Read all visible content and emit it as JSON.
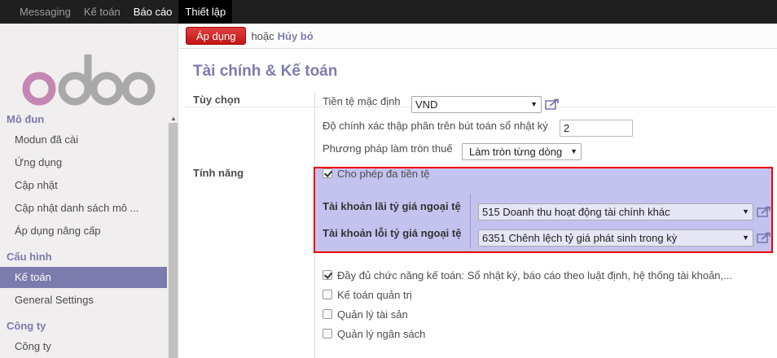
{
  "topbar": {
    "items": [
      "Messaging",
      "Kế toán",
      "Báo cáo",
      "Thiết lập"
    ]
  },
  "sidebar": {
    "sections": [
      {
        "title": "Mô đun",
        "items": [
          "Modun đã cài",
          "Ứng dụng",
          "Cập nhật",
          "Cập nhật danh sách mô ...",
          "Áp dụng nâng cấp"
        ]
      },
      {
        "title": "Cấu hình",
        "items": [
          "Kế toán",
          "General Settings"
        ]
      },
      {
        "title": "Công ty",
        "items": [
          "Công ty"
        ]
      }
    ],
    "active_item": "Kế toán"
  },
  "control_panel": {
    "apply_label": "Áp dụng",
    "or_label": "hoặc",
    "cancel_label": "Hủy bỏ"
  },
  "page_title": "Tài chính & Kế toán",
  "options": {
    "label": "Tùy chọn",
    "currency_label": "Tiền tệ mặc định",
    "currency_value": "VND",
    "precision_label": "Độ chính xác thập phân trên bút toán sổ nhật ký",
    "precision_value": "2",
    "rounding_label": "Phương pháp làm tròn thuế",
    "rounding_value": "Làm tròn từng dòng"
  },
  "features": {
    "label": "Tính năng",
    "multi_currency_label": "Cho phép đa tiền tệ",
    "multi_currency_checked": true,
    "gain_account_label": "Tài khoản lãi tỷ giá ngoại tệ",
    "gain_account_value": "515 Doanh thu hoạt động tài chính khác",
    "loss_account_label": "Tài khoản lỗi tỷ giá ngoại tệ",
    "loss_account_value": "6351 Chênh lệch tỷ giá phát sinh trong kỳ",
    "checkboxes": [
      {
        "label": "Đầy đủ chức năng kế toán: Sổ nhật ký, báo cáo theo luật định, hệ thống tài khoản,...",
        "checked": true
      },
      {
        "label": "Kế toán quản trị",
        "checked": false
      },
      {
        "label": "Quản lý tài sản",
        "checked": false
      },
      {
        "label": "Quản lý ngân sách",
        "checked": false
      }
    ]
  },
  "colors": {
    "accent": "#7c7bad",
    "apply": "#c11616",
    "highlight": "#c4c3ef",
    "outline": "#e00000"
  }
}
